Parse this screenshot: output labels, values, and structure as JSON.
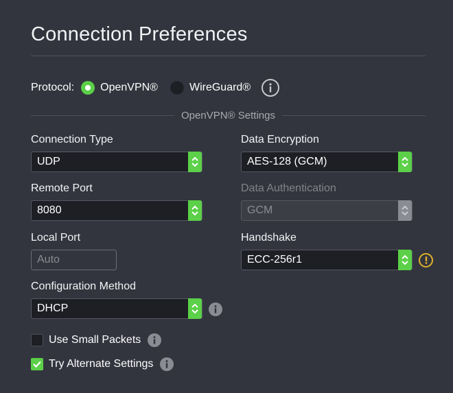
{
  "page": {
    "title": "Connection Preferences"
  },
  "protocol": {
    "label": "Protocol:",
    "options": [
      {
        "label": "OpenVPN®",
        "selected": true
      },
      {
        "label": "WireGuard®",
        "selected": false
      }
    ],
    "info_icon": "info-outline-icon"
  },
  "section": {
    "title": "OpenVPN® Settings"
  },
  "fields": {
    "connection_type": {
      "label": "Connection Type",
      "value": "UDP"
    },
    "data_encryption": {
      "label": "Data Encryption",
      "value": "AES-128 (GCM)"
    },
    "remote_port": {
      "label": "Remote Port",
      "value": "8080"
    },
    "data_authentication": {
      "label": "Data Authentication",
      "value": "GCM",
      "disabled": true
    },
    "local_port": {
      "label": "Local Port",
      "placeholder": "Auto"
    },
    "handshake": {
      "label": "Handshake",
      "value": "ECC-256r1",
      "warning_icon": "warning-icon"
    },
    "configuration_method": {
      "label": "Configuration Method",
      "value": "DHCP",
      "info_icon": "info-icon"
    }
  },
  "checkboxes": {
    "small_packets": {
      "label": "Use Small Packets",
      "checked": false
    },
    "alternate_settings": {
      "label": "Try Alternate Settings",
      "checked": true
    }
  },
  "colors": {
    "background": "#33353e",
    "accent": "#5bd048",
    "input_bg": "#1d1f25",
    "warning": "#e0b12a",
    "muted": "#8a8c93"
  }
}
